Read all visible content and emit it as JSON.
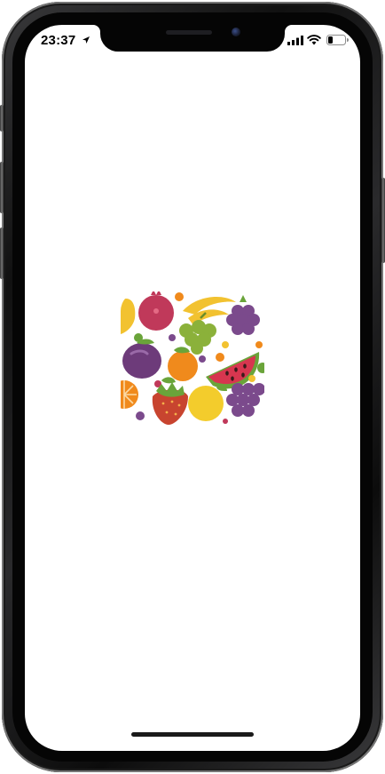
{
  "status_bar": {
    "time": "23:37",
    "icons": [
      "location-arrow-icon",
      "cellular-signal-icon",
      "wifi-icon",
      "battery-icon"
    ]
  },
  "splash": {
    "logo_icon": "fruit-pattern-logo-icon"
  },
  "colors": {
    "screen_background": "#ffffff",
    "pomegranate": "#c0395a",
    "banana": "#f2c230",
    "grapes": "#8bb13a",
    "blackberry": "#7b4a8c",
    "plum": "#6d3b7a",
    "apricot": "#f08a1c",
    "watermelon_flesh": "#d7364f",
    "watermelon_rind": "#6aa43a",
    "strawberry": "#c8442f",
    "lemon": "#f3cc2c",
    "orange": "#f08a1c"
  }
}
